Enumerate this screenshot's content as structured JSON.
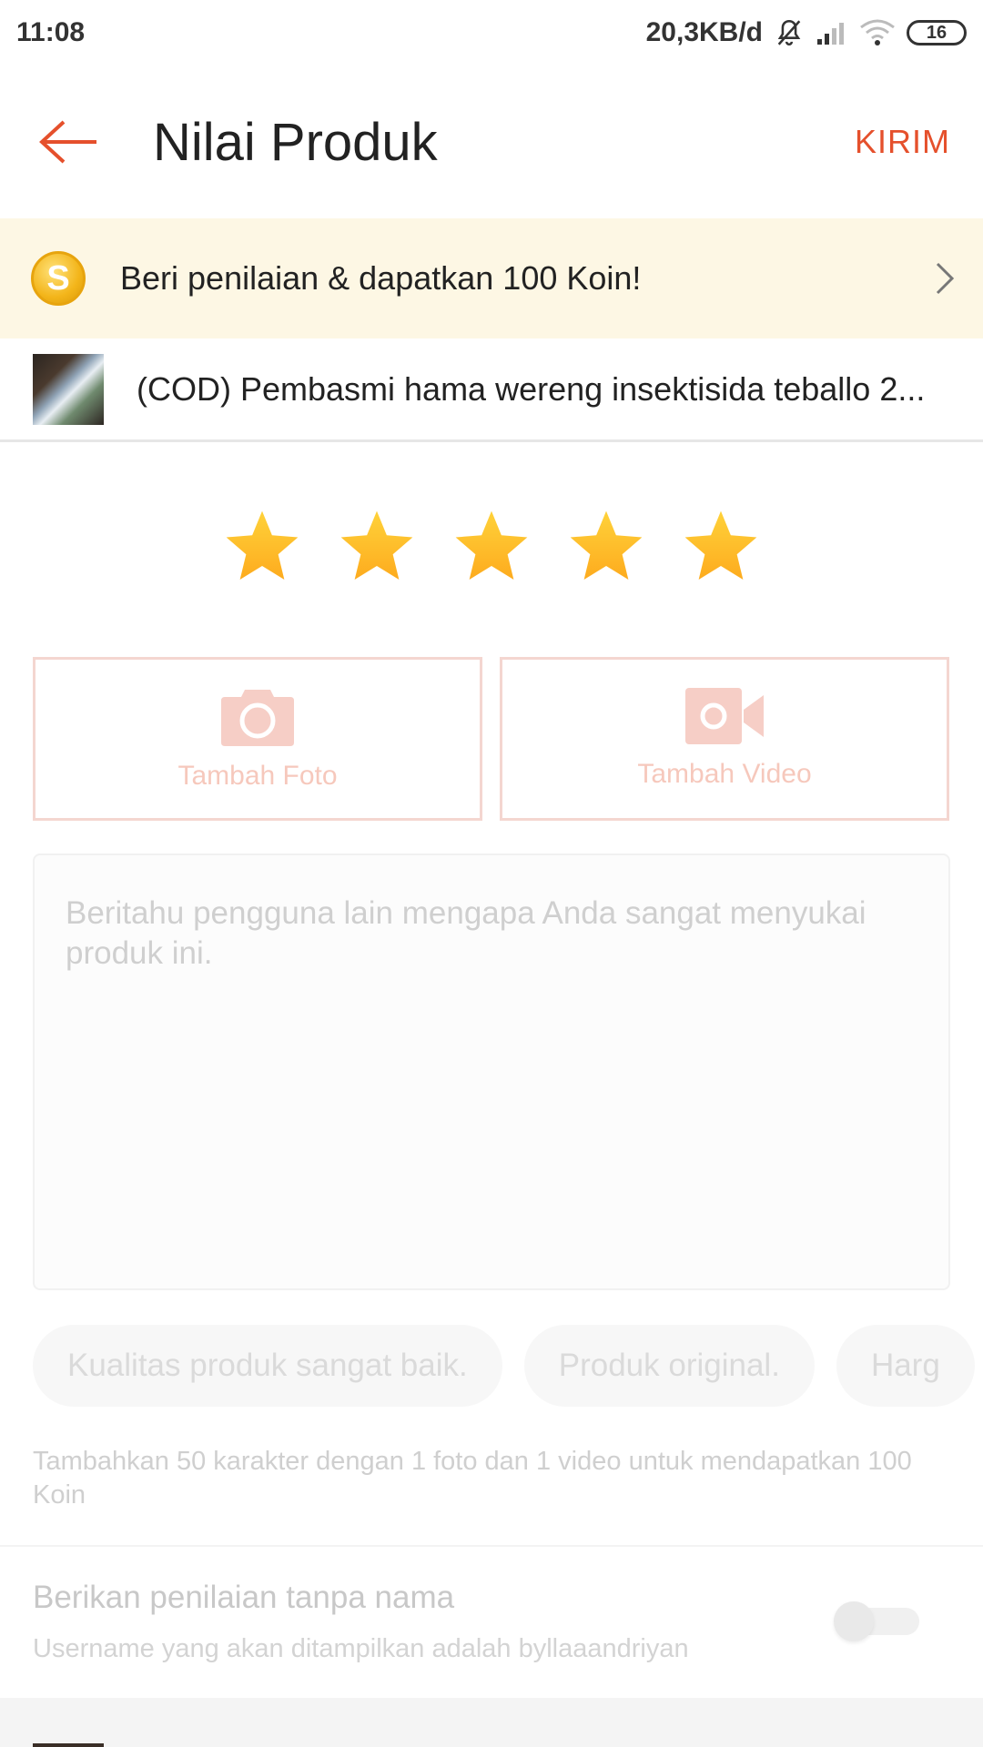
{
  "status_bar": {
    "time": "11:08",
    "network_speed": "20,3KB/d",
    "battery": "16",
    "icons": [
      "bell-off-icon",
      "signal-icon",
      "wifi-icon",
      "battery-icon"
    ]
  },
  "app_bar": {
    "title": "Nilai Produk",
    "submit_label": "KIRIM",
    "back_icon": "arrow-left-icon"
  },
  "coin_banner": {
    "coin_letter": "S",
    "text": "Beri penilaian & dapatkan 100 Koin!",
    "icon": "chevron-right-icon"
  },
  "product": {
    "name": "(COD) Pembasmi hama wereng insektisida teballo 2..."
  },
  "rating": {
    "value": 5,
    "max": 5
  },
  "media": {
    "photo_label": "Tambah Foto",
    "video_label": "Tambah Video"
  },
  "review": {
    "placeholder": "Beritahu pengguna lain mengapa Anda sangat menyukai produk ini."
  },
  "chips": [
    "Kualitas produk sangat baik.",
    "Produk original.",
    "Harg"
  ],
  "hint": "Tambahkan 50 karakter dengan 1 foto dan 1 video untuk mendapatkan 100 Koin",
  "anonymous": {
    "title": "Berikan penilaian tanpa nama",
    "subtitle": "Username yang akan ditampilkan adalah byllaaandriyan",
    "enabled": false
  },
  "colors": {
    "accent": "#e5502c",
    "banner_bg": "#fdf7e4",
    "star": "#fdb823",
    "media_border": "#f4d6d0"
  }
}
